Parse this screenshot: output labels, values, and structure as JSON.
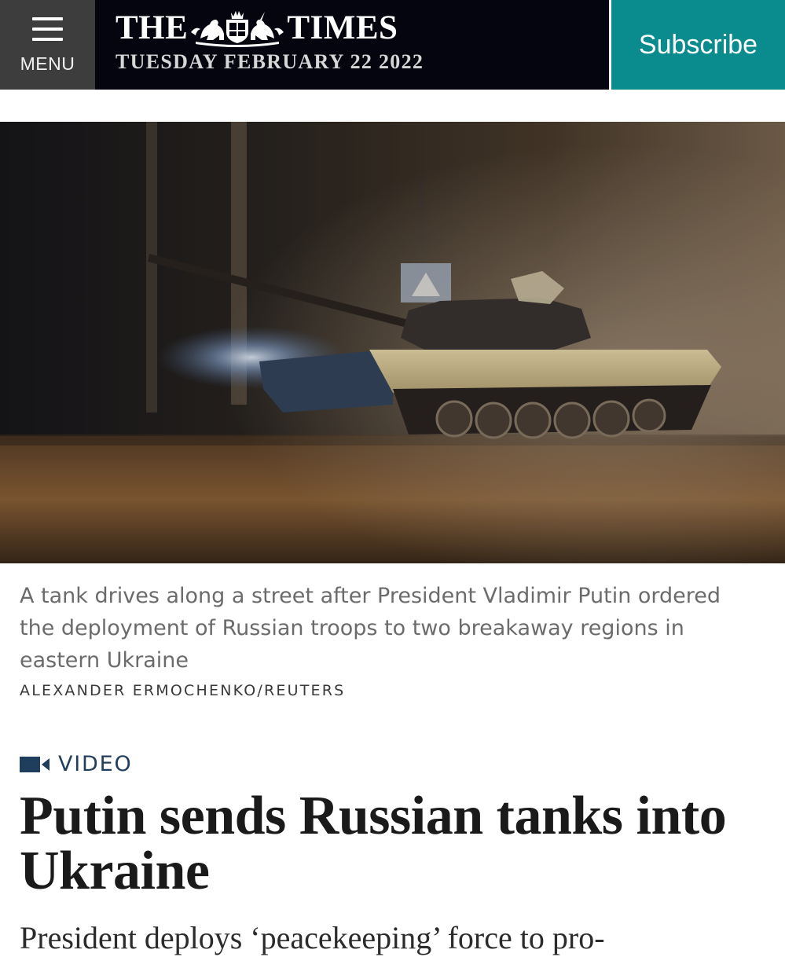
{
  "header": {
    "menu_label": "MENU",
    "logo_left": "THE",
    "logo_right": "TIMES",
    "date": "TUESDAY FEBRUARY 22 2022",
    "subscribe_label": "Subscribe",
    "colors": {
      "menu_bg": "#3d3d3d",
      "masthead_bg": "#050510",
      "subscribe_bg": "#0a8b8e"
    }
  },
  "hero": {
    "subject": "tank-on-night-street"
  },
  "caption": {
    "text": "A tank drives along a street after President Vladimir Putin ordered the deployment of Russian troops to two breakaway regions in eastern Ukraine",
    "credit": "ALEXANDER ERMOCHENKO/REUTERS"
  },
  "article": {
    "tag_icon": "video-camera-icon",
    "tag_label": "VIDEO",
    "headline": "Putin sends Russian tanks into Ukraine",
    "standfirst": "President deploys ‘peacekeeping’ force to pro-"
  }
}
